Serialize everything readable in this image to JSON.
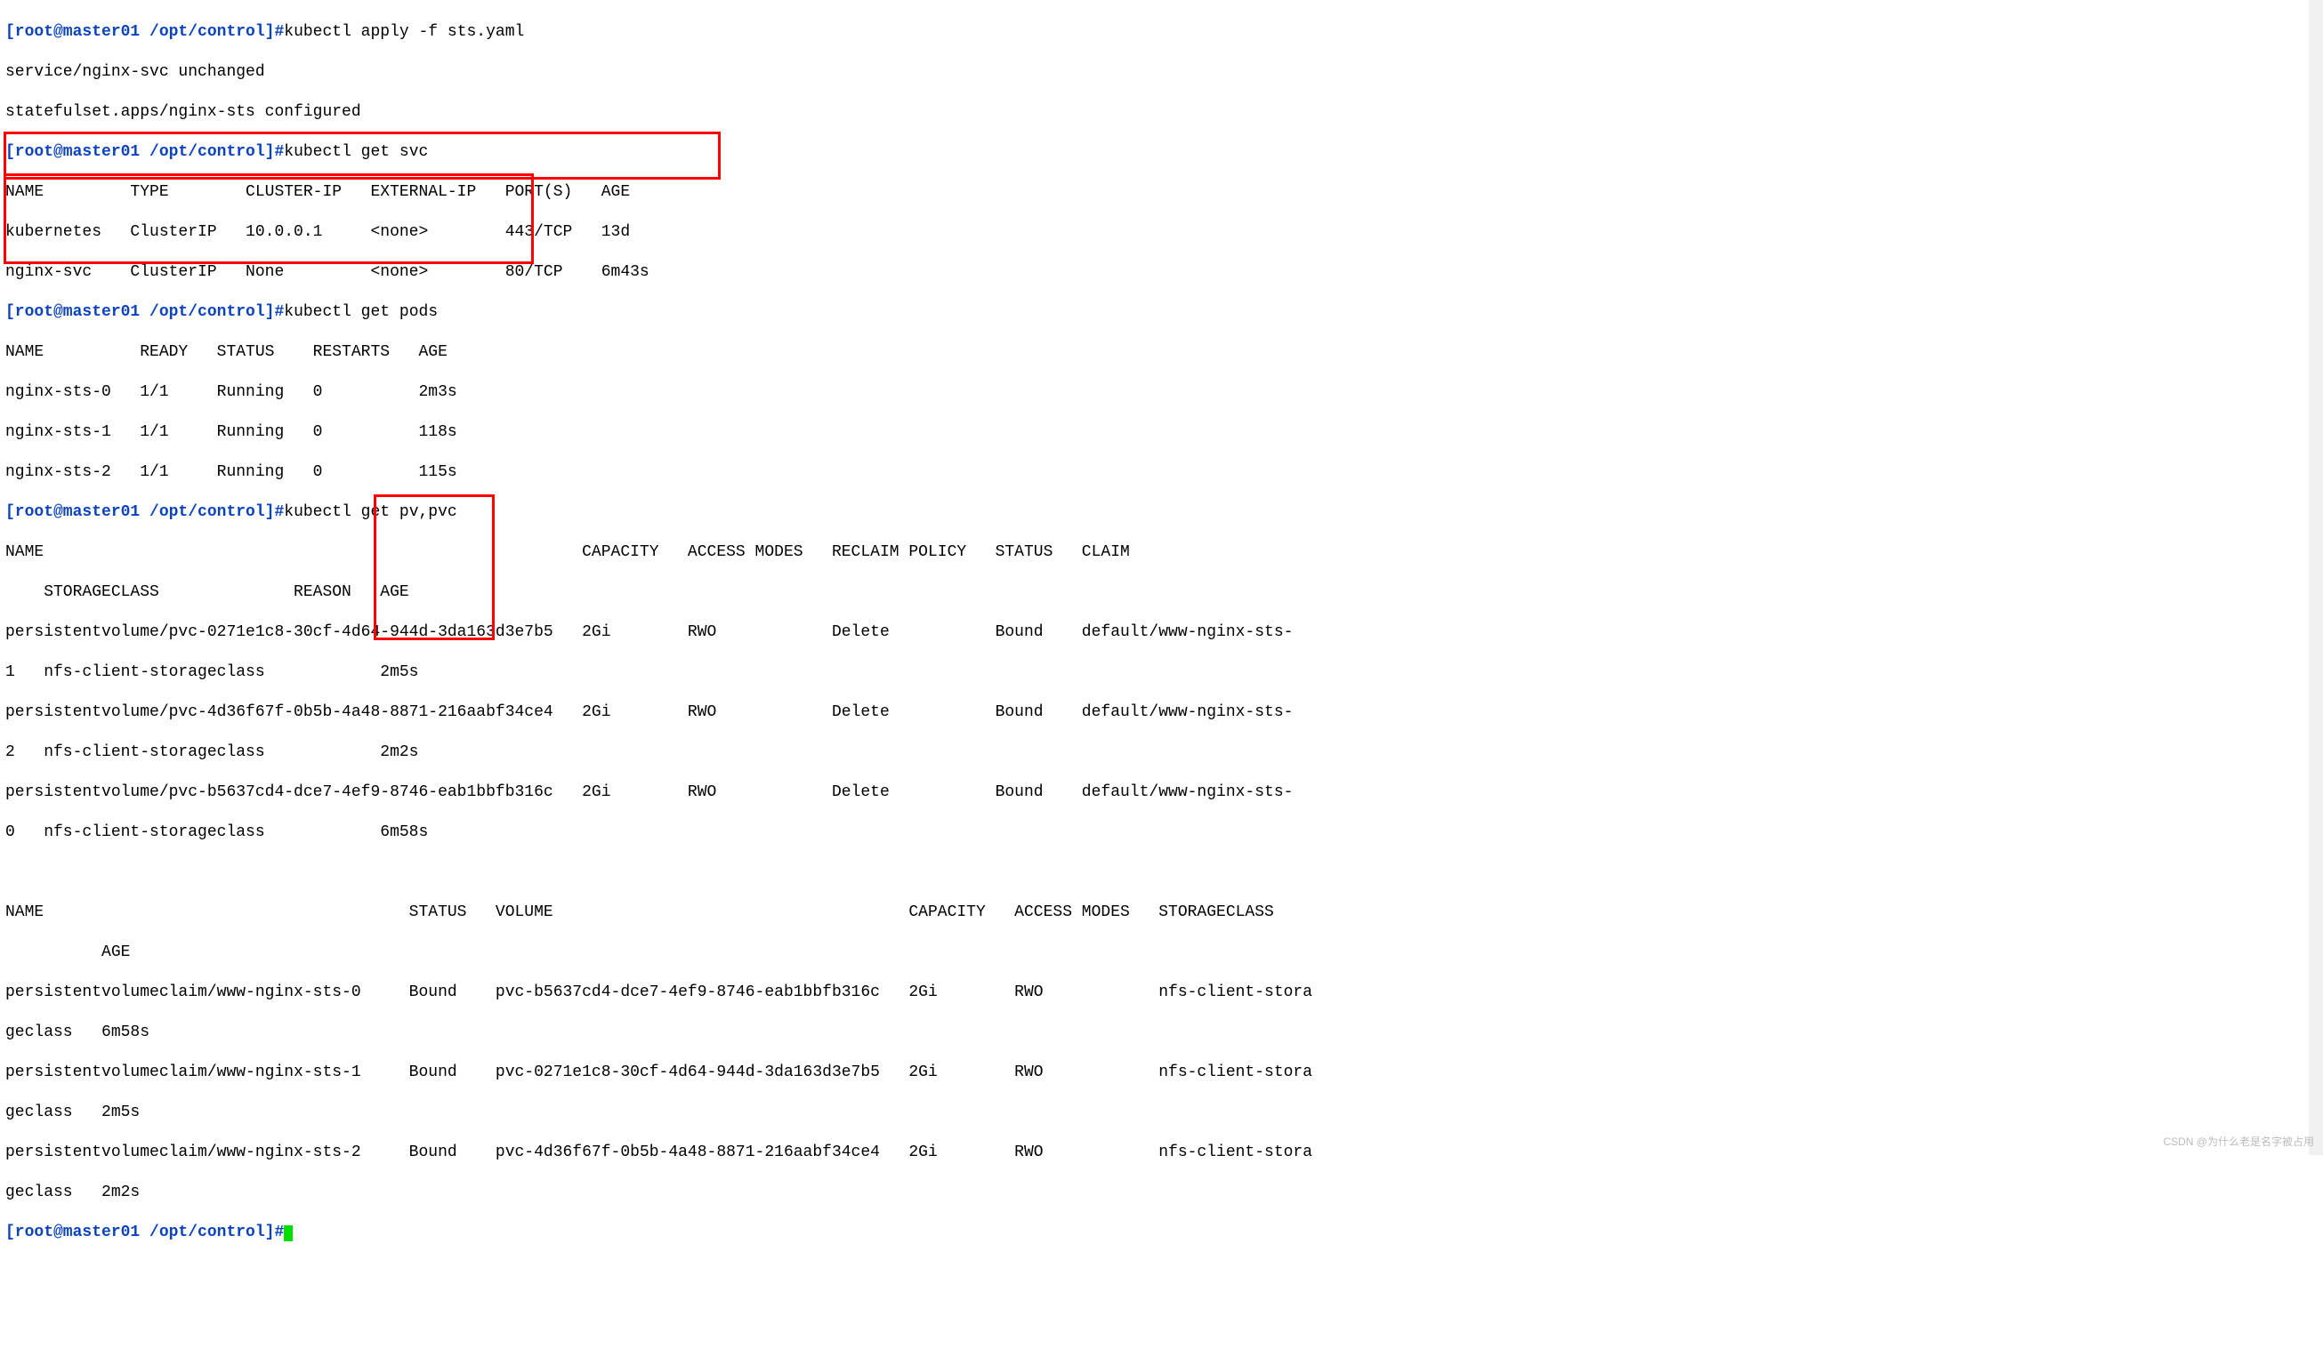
{
  "prompt": "[root@master01 /opt/control]#",
  "cmds": {
    "apply": "kubectl apply -f sts.yaml",
    "getsvc": "kubectl get svc",
    "getpods": "kubectl get pods",
    "getpvpvc": "kubectl get pv,pvc"
  },
  "apply_out": {
    "l1": "service/nginx-svc unchanged",
    "l2": "statefulset.apps/nginx-sts configured"
  },
  "svc": {
    "header": "NAME         TYPE        CLUSTER-IP   EXTERNAL-IP   PORT(S)   AGE",
    "rows": [
      "kubernetes   ClusterIP   10.0.0.1     <none>        443/TCP   13d",
      "nginx-svc    ClusterIP   None         <none>        80/TCP    6m43s"
    ]
  },
  "pods": {
    "header": "NAME          READY   STATUS    RESTARTS   AGE",
    "rows": [
      "nginx-sts-0   1/1     Running   0          2m3s",
      "nginx-sts-1   1/1     Running   0          118s",
      "nginx-sts-2   1/1     Running   0          115s"
    ]
  },
  "pv": {
    "h1": "NAME                                                        CAPACITY   ACCESS MODES   RECLAIM POLICY   STATUS   CLAIM",
    "h2": "    STORAGECLASS              REASON   AGE",
    "r1a": "persistentvolume/pvc-0271e1c8-30cf-4d64-944d-3da163d3e7b5   2Gi        RWO            Delete           Bound    default/www-nginx-sts-",
    "r1b": "1   nfs-client-storageclass            2m5s",
    "r2a": "persistentvolume/pvc-4d36f67f-0b5b-4a48-8871-216aabf34ce4   2Gi        RWO            Delete           Bound    default/www-nginx-sts-",
    "r2b": "2   nfs-client-storageclass            2m2s",
    "r3a": "persistentvolume/pvc-b5637cd4-dce7-4ef9-8746-eab1bbfb316c   2Gi        RWO            Delete           Bound    default/www-nginx-sts-",
    "r3b": "0   nfs-client-storageclass            6m58s"
  },
  "blank": " ",
  "pvc": {
    "h1": "NAME                                      STATUS   VOLUME                                     CAPACITY   ACCESS MODES   STORAGECLASS",
    "h2": "          AGE",
    "r1a": "persistentvolumeclaim/www-nginx-sts-0     Bound    pvc-b5637cd4-dce7-4ef9-8746-eab1bbfb316c   2Gi        RWO            nfs-client-stora",
    "r1b": "geclass   6m58s",
    "r2a": "persistentvolumeclaim/www-nginx-sts-1     Bound    pvc-0271e1c8-30cf-4d64-944d-3da163d3e7b5   2Gi        RWO            nfs-client-stora",
    "r2b": "geclass   2m5s",
    "r3a": "persistentvolumeclaim/www-nginx-sts-2     Bound    pvc-4d36f67f-0b5b-4a48-8871-216aabf34ce4   2Gi        RWO            nfs-client-stora",
    "r3b": "geclass   2m2s"
  },
  "watermark": "CSDN @为什么老是名字被占用"
}
